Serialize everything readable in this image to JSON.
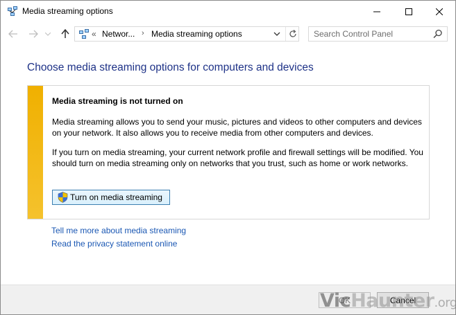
{
  "window": {
    "title": "Media streaming options",
    "controls": {
      "minimize": "minimize-icon",
      "maximize": "maximize-icon",
      "close": "close-icon"
    }
  },
  "nav": {
    "address": {
      "overflow": "«",
      "segment1": "Networ...",
      "separator": "›",
      "segment2": "Media streaming options"
    },
    "search": {
      "placeholder": "Search Control Panel"
    }
  },
  "main": {
    "title": "Choose media streaming options for computers and devices",
    "panel": {
      "heading": "Media streaming is not turned on",
      "paragraph1": "Media streaming allows you to send your music, pictures and videos to other computers and devices on your network.  It also allows you to receive media from other computers and devices.",
      "paragraph2": "If you turn on media streaming, your current network profile and firewall settings will be modified. You should turn on media streaming only on networks that you trust, such as home or work networks.",
      "button_label": "Turn on media streaming",
      "accent_color": "#f2b705"
    },
    "links": [
      "Tell me more about media streaming",
      "Read the privacy statement online"
    ]
  },
  "footer": {
    "ok_label": "OK",
    "cancel_label": "Cancel"
  },
  "watermark": {
    "part1": "Vic",
    "part2": "Haunter",
    "part3": ".org"
  },
  "colors": {
    "title_blue": "#1e3287",
    "link_blue": "#1a57b3"
  }
}
